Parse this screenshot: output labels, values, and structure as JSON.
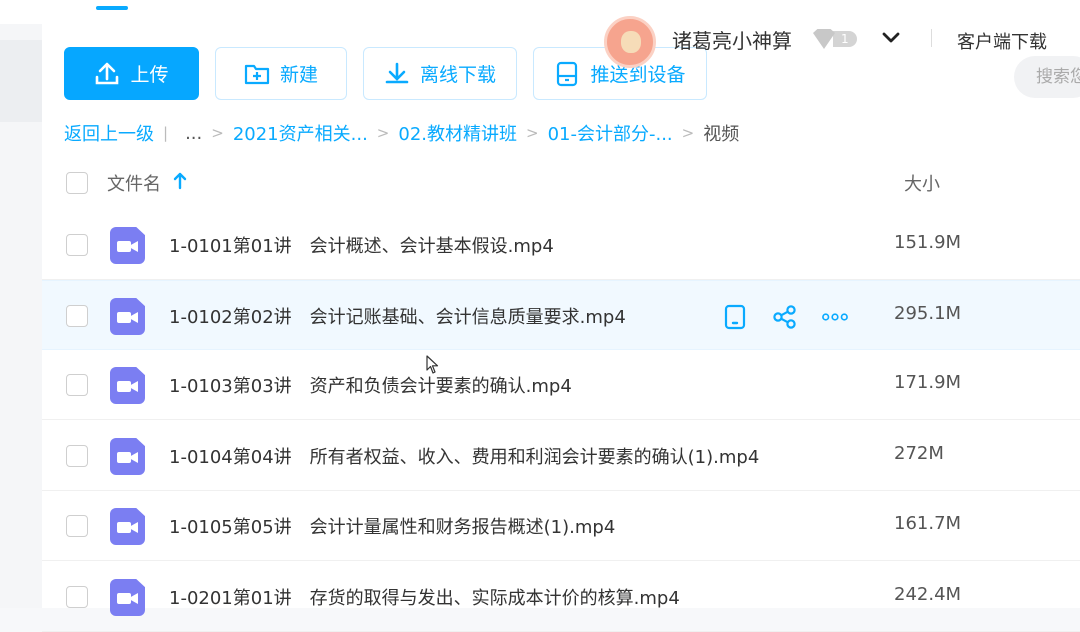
{
  "toolbar": {
    "upload_label": "上传",
    "new_label": "新建",
    "offline_label": "离线下载",
    "push_label": "推送到设备",
    "search_placeholder": "搜索您"
  },
  "user": {
    "name": "诸葛亮小神算",
    "vip_level": "1",
    "client_download": "客户端下载"
  },
  "breadcrumb": {
    "back": "返回上一级",
    "ellipsis": "...",
    "items": [
      "2021资产相关...",
      "02.教材精讲班",
      "01-会计部分-..."
    ],
    "current": "视频"
  },
  "table": {
    "col_name": "文件名",
    "col_size": "大小",
    "rows": [
      {
        "name": "1-0101第01讲　会计概述、会计基本假设.mp4",
        "size": "151.9M"
      },
      {
        "name": "1-0102第02讲　会计记账基础、会计信息质量要求.mp4",
        "size": "295.1M"
      },
      {
        "name": "1-0103第03讲　资产和负债会计要素的确认.mp4",
        "size": "171.9M"
      },
      {
        "name": "1-0104第04讲　所有者权益、收入、费用和利润会计要素的确认(1).mp4",
        "size": "272M"
      },
      {
        "name": "1-0105第05讲　会计计量属性和财务报告概述(1).mp4",
        "size": "161.7M"
      },
      {
        "name": "1-0201第01讲　存货的取得与发出、实际成本计价的核算.mp4",
        "size": "242.4M"
      }
    ]
  },
  "colors": {
    "accent": "#09aaff",
    "video_icon": "#7b7ef2"
  }
}
